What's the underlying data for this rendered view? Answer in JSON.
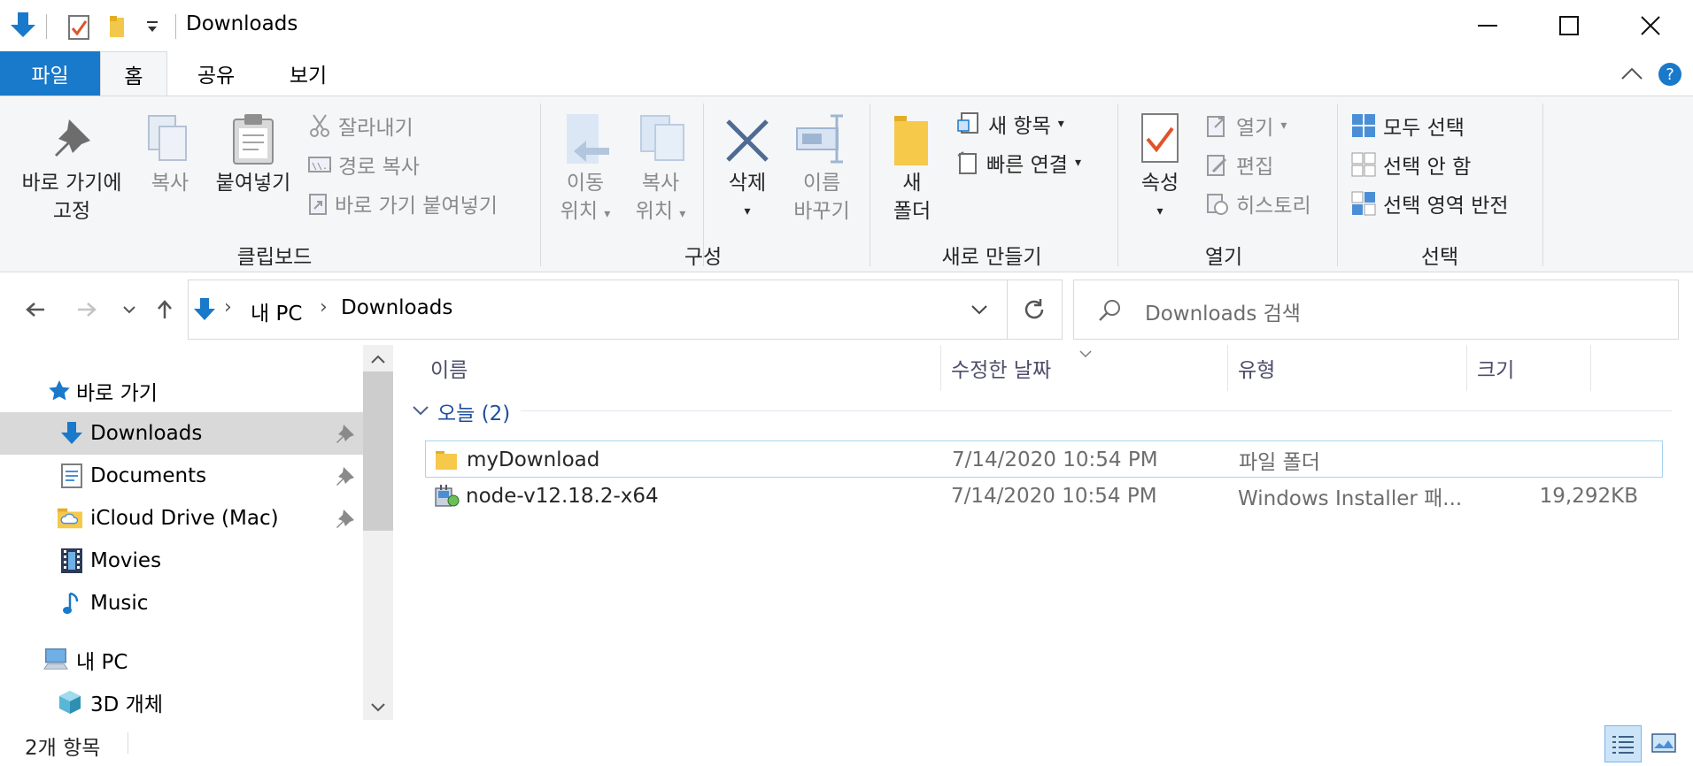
{
  "window": {
    "title": "Downloads"
  },
  "tabs": {
    "file": "파일",
    "home": "홈",
    "share": "공유",
    "view": "보기"
  },
  "ribbon": {
    "clipboard": {
      "label": "클립보드",
      "pin_line1": "바로 가기에",
      "pin_line2": "고정",
      "copy": "복사",
      "paste": "붙여넣기",
      "cut": "잘라내기",
      "copy_path": "경로 복사",
      "paste_shortcut": "바로 가기 붙여넣기"
    },
    "organize": {
      "label": "구성",
      "move_line1": "이동",
      "move_line2": "위치",
      "copy_line1": "복사",
      "copy_line2": "위치",
      "delete": "삭제",
      "rename_line1": "이름",
      "rename_line2": "바꾸기"
    },
    "new": {
      "label": "새로 만들기",
      "folder_line1": "새",
      "folder_line2": "폴더",
      "new_item": "새 항목",
      "easy_access": "빠른 연결"
    },
    "open": {
      "label": "열기",
      "properties": "속성",
      "open": "열기",
      "edit": "편집",
      "history": "히스토리"
    },
    "select": {
      "label": "선택",
      "select_all": "모두 선택",
      "select_none": "선택 안 함",
      "invert": "선택 영역 반전"
    }
  },
  "address": {
    "crumb_pc": "내 PC",
    "crumb_folder": "Downloads",
    "search_placeholder": "Downloads 검색"
  },
  "navpane": {
    "quick_access": "바로 가기",
    "items": [
      {
        "label": "Downloads"
      },
      {
        "label": "Documents"
      },
      {
        "label": "iCloud Drive (Mac)"
      },
      {
        "label": "Movies"
      },
      {
        "label": "Music"
      }
    ],
    "this_pc": "내 PC",
    "objects3d": "3D 개체"
  },
  "filelist": {
    "columns": {
      "name": "이름",
      "date": "수정한 날짜",
      "type": "유형",
      "size": "크기"
    },
    "group": "오늘 (2)",
    "rows": [
      {
        "name": "myDownload",
        "date": "7/14/2020 10:54 PM",
        "type": "파일 폴더",
        "size": ""
      },
      {
        "name": "node-v12.18.2-x64",
        "date": "7/14/2020 10:54 PM",
        "type": "Windows Installer 패...",
        "size": "19,292KB"
      }
    ]
  },
  "status": {
    "count": "2개 항목"
  },
  "colors": {
    "accent": "#1979ca",
    "ribbon_bg": "#f5f6f7",
    "selected_bg": "#d9d9d9",
    "group_text": "#1f4e9c"
  }
}
